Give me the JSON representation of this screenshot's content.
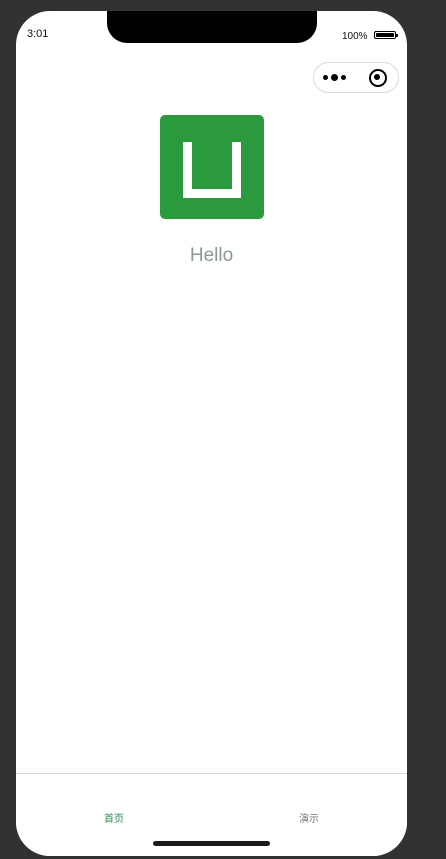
{
  "status_bar": {
    "time": "3:01",
    "battery_percent": "100%"
  },
  "capsule": {
    "menu_icon": "more-dots-icon",
    "close_icon": "target-close-icon"
  },
  "logo": {
    "icon": "uniapp-logo-icon",
    "color": "#2b9a3e"
  },
  "main": {
    "greeting": "Hello"
  },
  "tabbar": {
    "tabs": [
      {
        "label": "首页",
        "active": true,
        "color": "#2e8b57"
      },
      {
        "label": "演示",
        "active": false,
        "color": "#777777"
      }
    ]
  }
}
